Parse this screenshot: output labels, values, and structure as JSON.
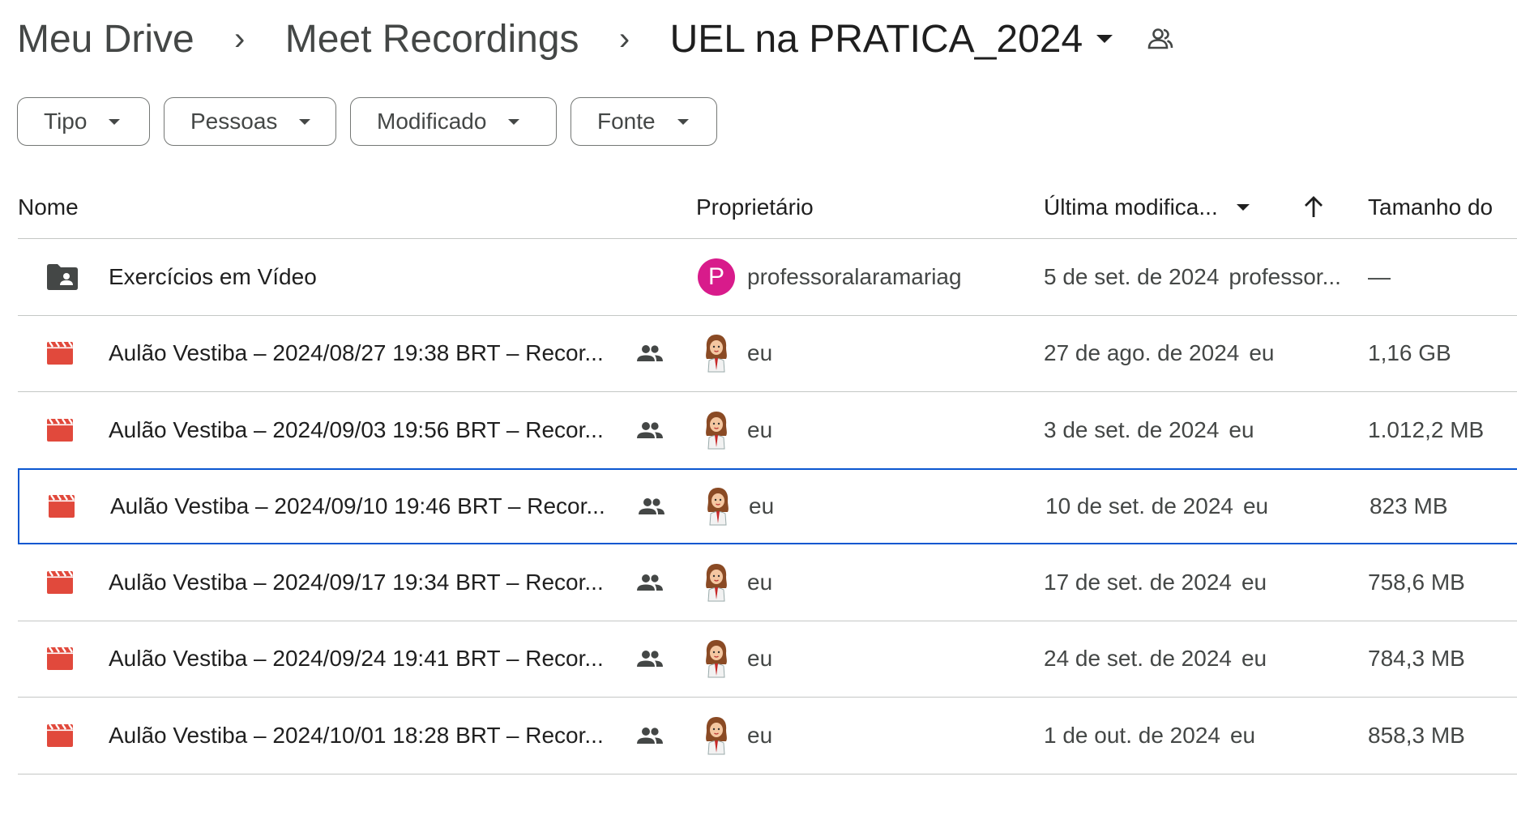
{
  "breadcrumb": {
    "items": [
      "Meu Drive",
      "Meet Recordings"
    ],
    "separator": "›",
    "current": "UEL na PRATICA_2024"
  },
  "filters": [
    {
      "label": "Tipo"
    },
    {
      "label": "Pessoas"
    },
    {
      "label": "Modificado"
    },
    {
      "label": "Fonte"
    }
  ],
  "columns": {
    "name": "Nome",
    "owner": "Proprietário",
    "modified": "Última modifica...",
    "size": "Tamanho do"
  },
  "rows": [
    {
      "type": "folder",
      "name": "Exercícios em Vídeo",
      "shared": false,
      "owner": "professoralaramariag",
      "owner_avatar": "P",
      "modified": "5 de set. de 2024",
      "modified_by": "professor...",
      "size": "—"
    },
    {
      "type": "video",
      "name": "Aulão Vestiba – 2024/08/27 19:38 BRT – Recor...",
      "shared": true,
      "owner": "eu",
      "modified": "27 de ago. de 2024",
      "modified_by": "eu",
      "size": "1,16 GB"
    },
    {
      "type": "video",
      "name": "Aulão Vestiba – 2024/09/03 19:56 BRT – Recor...",
      "shared": true,
      "owner": "eu",
      "modified": "3 de set. de 2024",
      "modified_by": "eu",
      "size": "1.012,2 MB"
    },
    {
      "type": "video",
      "name": "Aulão Vestiba – 2024/09/10 19:46 BRT – Recor...",
      "shared": true,
      "owner": "eu",
      "modified": "10 de set. de 2024",
      "modified_by": "eu",
      "size": "823 MB",
      "selected": true
    },
    {
      "type": "video",
      "name": "Aulão Vestiba – 2024/09/17 19:34 BRT – Recor...",
      "shared": true,
      "owner": "eu",
      "modified": "17 de set. de 2024",
      "modified_by": "eu",
      "size": "758,6 MB"
    },
    {
      "type": "video",
      "name": "Aulão Vestiba – 2024/09/24 19:41 BRT – Recor...",
      "shared": true,
      "owner": "eu",
      "modified": "24 de set. de 2024",
      "modified_by": "eu",
      "size": "784,3 MB"
    },
    {
      "type": "video",
      "name": "Aulão Vestiba – 2024/10/01 18:28 BRT – Recor...",
      "shared": true,
      "owner": "eu",
      "modified": "1 de out. de 2024",
      "modified_by": "eu",
      "size": "858,3 MB"
    }
  ],
  "colors": {
    "video_icon": "#e1493c",
    "folder_icon": "#444746",
    "selection_border": "#0b57d0",
    "owner_avatar_bg": "#d81b8b"
  }
}
